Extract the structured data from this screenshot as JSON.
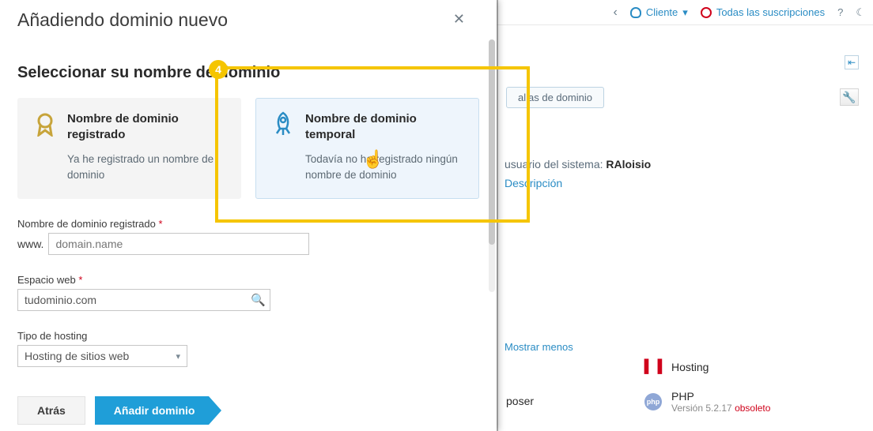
{
  "background": {
    "back_arrow": "‹",
    "user_label": "Cliente",
    "user_caret": "▾",
    "subscriptions_label": "Todas las suscripciones",
    "help": "?",
    "night": "☾",
    "side_toggle": "⇤",
    "alias_tab": "alias de dominio",
    "tools_icon": "🔧",
    "system_user_prefix": "usuario del sistema: ",
    "system_user_value": "RAloisio",
    "description_link": "Descripción",
    "show_less": "Mostrar menos",
    "features": {
      "hosting": {
        "label": "Hosting"
      },
      "php": {
        "label": "PHP",
        "version_prefix": "Versión 5.2.17 ",
        "obsolete": "obsoleto"
      },
      "composer_fragment": "poser"
    }
  },
  "modal": {
    "title": "Añadiendo dominio nuevo",
    "close_glyph": "✕",
    "section_title": "Seleccionar su nombre de dominio",
    "cards": {
      "registered": {
        "title": "Nombre de dominio registrado",
        "desc": "Ya he registrado un nombre de dominio"
      },
      "temporary": {
        "title": "Nombre de dominio temporal",
        "desc": "Todavía no he registrado ningún nombre de dominio"
      }
    },
    "fields": {
      "registered_domain_label": "Nombre de dominio registrado",
      "www_prefix": "www.",
      "domain_placeholder": "domain.name",
      "webspace_label": "Espacio web",
      "webspace_value": "tudominio.com",
      "hosting_type_label": "Tipo de hosting",
      "hosting_type_value": "Hosting de sitios web"
    },
    "footer": {
      "back": "Atrás",
      "submit": "Añadir dominio"
    }
  },
  "step": {
    "number": "4"
  }
}
